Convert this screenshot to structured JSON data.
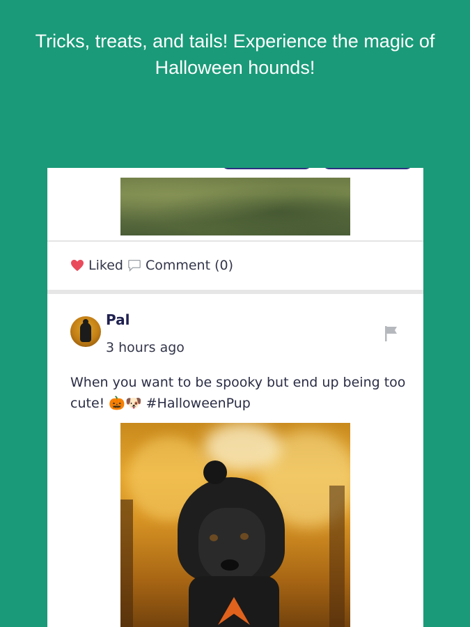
{
  "headline": "Tricks, treats, and tails! Experience the magic of Halloween hounds!",
  "colors": {
    "background": "#1a9a78",
    "liked_heart": "#e94b5c",
    "username": "#1f2150"
  },
  "previous_post": {
    "actions": {
      "liked_label": "Liked",
      "comment_label": "Comment (0)"
    }
  },
  "post": {
    "username": "Pal",
    "timestamp": "3 hours ago",
    "text": "When you want to be spooky but end up being too cute! 🎃🐶 #HalloweenPup",
    "icons": [
      "avatar",
      "flag-icon"
    ]
  }
}
